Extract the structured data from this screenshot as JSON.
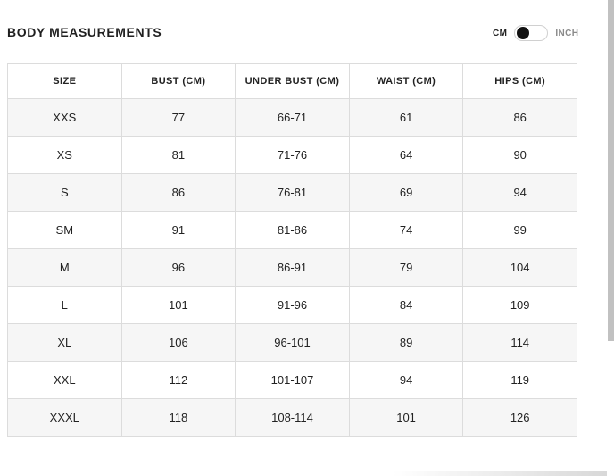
{
  "header": {
    "title": "BODY MEASUREMENTS",
    "unit_toggle": {
      "left_label": "CM",
      "right_label": "INCH",
      "selected": "CM"
    }
  },
  "table": {
    "headers": [
      "SIZE",
      "BUST (CM)",
      "UNDER BUST (CM)",
      "WAIST (CM)",
      "HIPS (CM)"
    ],
    "rows": [
      [
        "XXS",
        "77",
        "66-71",
        "61",
        "86"
      ],
      [
        "XS",
        "81",
        "71-76",
        "64",
        "90"
      ],
      [
        "S",
        "86",
        "76-81",
        "69",
        "94"
      ],
      [
        "SM",
        "91",
        "81-86",
        "74",
        "99"
      ],
      [
        "M",
        "96",
        "86-91",
        "79",
        "104"
      ],
      [
        "L",
        "101",
        "91-96",
        "84",
        "109"
      ],
      [
        "XL",
        "106",
        "96-101",
        "89",
        "114"
      ],
      [
        "XXL",
        "112",
        "101-107",
        "94",
        "119"
      ],
      [
        "XXXL",
        "118",
        "108-114",
        "101",
        "126"
      ]
    ]
  },
  "colors": {
    "text": "#222222",
    "row_alt": "#f6f6f6",
    "border": "#dcdcdc",
    "toggle_knob": "#111111",
    "inactive_label": "#8a8a8a"
  }
}
